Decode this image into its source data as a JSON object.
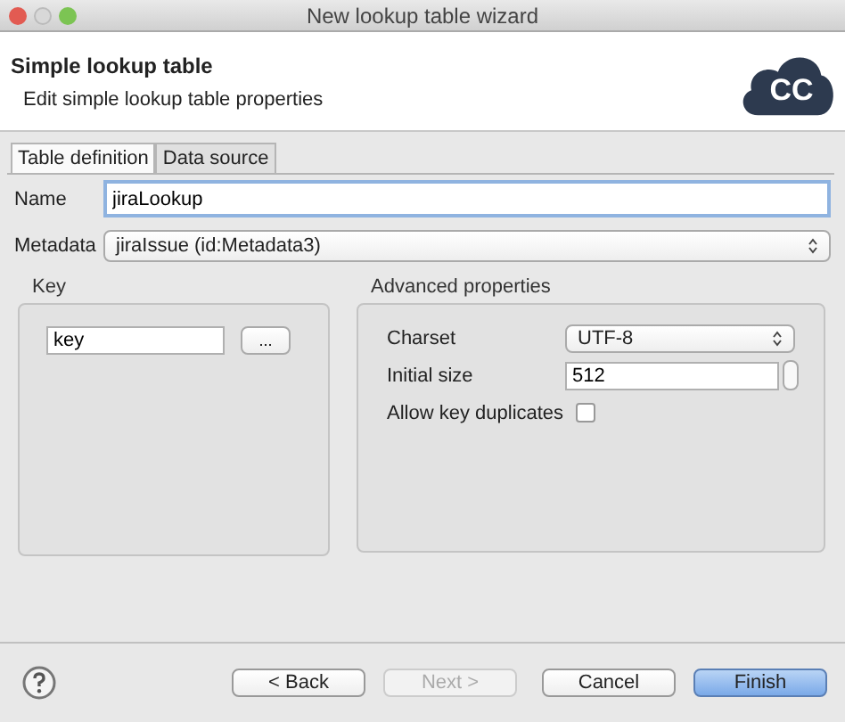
{
  "window": {
    "title": "New lookup table wizard"
  },
  "header": {
    "title": "Simple lookup table",
    "subtitle": "Edit simple lookup table properties",
    "logo_text": "CC"
  },
  "tabs": [
    {
      "label": "Table definition",
      "selected": true
    },
    {
      "label": "Data source",
      "selected": false
    }
  ],
  "name": {
    "label": "Name",
    "value": "jiraLookup"
  },
  "metadata": {
    "label": "Metadata",
    "value": "jiraIssue (id:Metadata3)"
  },
  "key_group": {
    "title": "Key",
    "value": "key",
    "button": "..."
  },
  "advanced": {
    "title": "Advanced properties",
    "charset_label": "Charset",
    "charset": "UTF-8",
    "size_label": "Initial size",
    "size": "512",
    "duplicates_label": "Allow key duplicates",
    "duplicates_checked": false
  },
  "buttons": [
    {
      "label": "< Back",
      "disabled": false,
      "default": false
    },
    {
      "label": "Next >",
      "disabled": true,
      "default": false
    },
    {
      "label": "Cancel",
      "disabled": false,
      "default": false
    },
    {
      "label": "Finish",
      "disabled": false,
      "default": true
    }
  ]
}
